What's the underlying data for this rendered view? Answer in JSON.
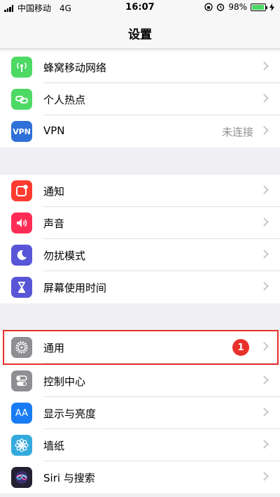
{
  "status_bar": {
    "carrier": "中国移动",
    "network": "4G",
    "time": "16:07",
    "battery": "98%"
  },
  "title": "设置",
  "groups": [
    [
      {
        "label": "蜂窝移动网络",
        "icon": "antenna-icon",
        "color": "#4cd964"
      },
      {
        "label": "个人热点",
        "icon": "chain-link-icon",
        "color": "#4cd964"
      },
      {
        "label": "VPN",
        "icon": "vpn-icon",
        "icon_text": "VPN",
        "color": "#2f6fd8",
        "value": "未连接"
      }
    ],
    [
      {
        "label": "通知",
        "icon": "notification-icon",
        "color": "#ff3b30"
      },
      {
        "label": "声音",
        "icon": "speaker-icon",
        "color": "#ff2d55"
      },
      {
        "label": "勿扰模式",
        "icon": "moon-icon",
        "color": "#5856d6"
      },
      {
        "label": "屏幕使用时间",
        "icon": "hourglass-icon",
        "color": "#5856d6"
      }
    ],
    [
      {
        "label": "通用",
        "icon": "gear-icon",
        "color": "#8e8e93",
        "badge": "1"
      },
      {
        "label": "控制中心",
        "icon": "toggle-switch-icon",
        "color": "#8e8e93"
      },
      {
        "label": "显示与亮度",
        "icon": "text-size-icon",
        "icon_text": "AA",
        "color": "#1a7cf5"
      },
      {
        "label": "墙纸",
        "icon": "flower-icon",
        "color": "#34aadc"
      },
      {
        "label": "Siri 与搜索",
        "icon": "siri-icon",
        "color": "#222233"
      }
    ]
  ]
}
